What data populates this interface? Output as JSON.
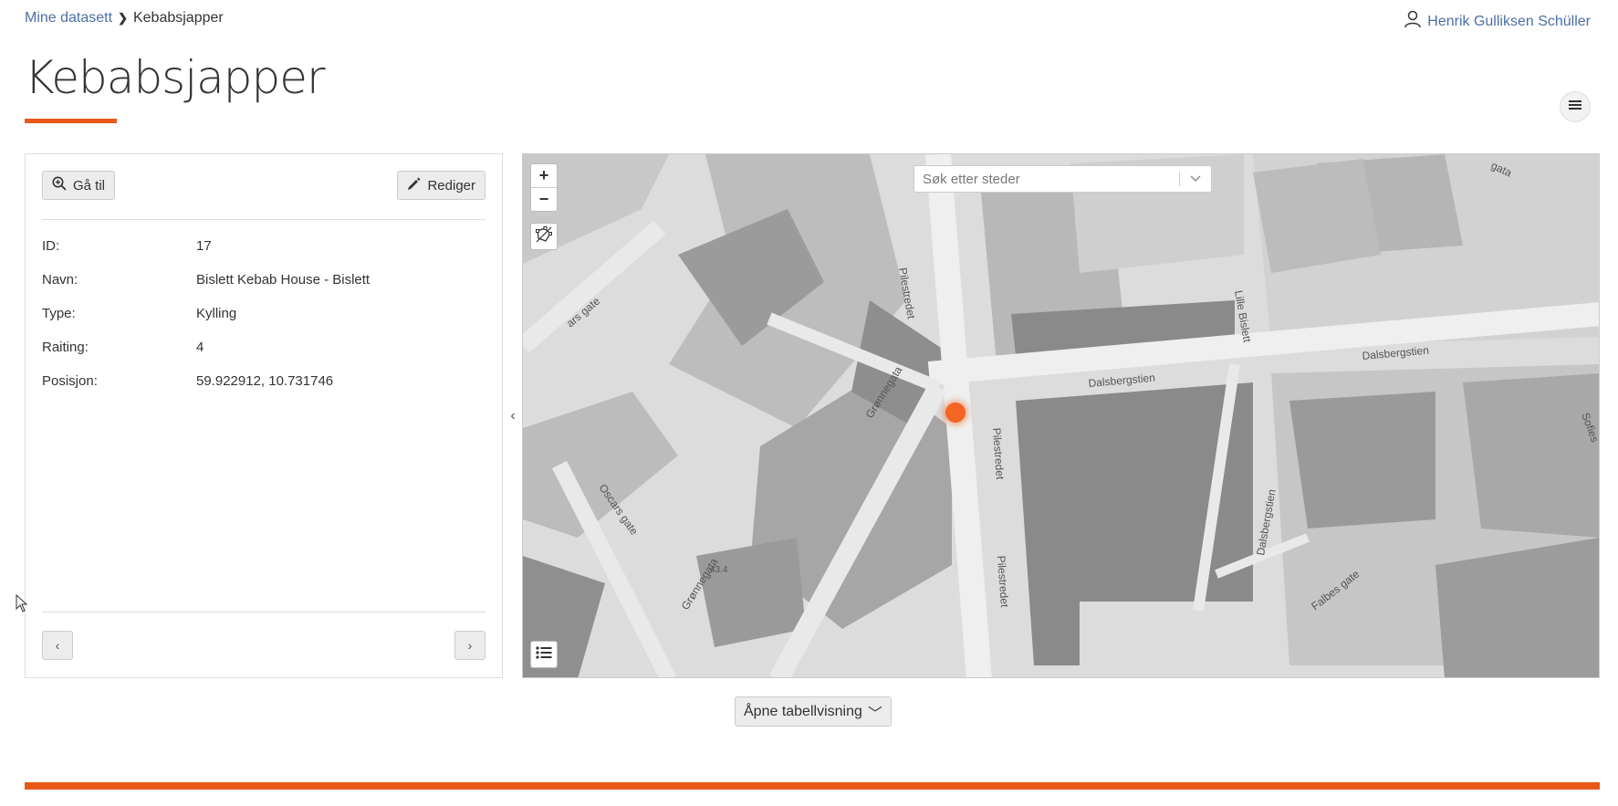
{
  "breadcrumb": {
    "parent": "Mine datasett",
    "current": "Kebabsjapper"
  },
  "user": {
    "name": "Henrik Gulliksen Schüller"
  },
  "page": {
    "title": "Kebabsjapper"
  },
  "detail": {
    "goto_label": "Gå til",
    "edit_label": "Rediger",
    "fields": [
      {
        "label": "ID:",
        "value": "17"
      },
      {
        "label": "Navn:",
        "value": "Bislett Kebab House - Bislett"
      },
      {
        "label": "Type:",
        "value": "Kylling"
      },
      {
        "label": "Raiting:",
        "value": "4"
      },
      {
        "label": "Posisjon:",
        "value": "59.922912, 10.731746"
      }
    ],
    "prev_label": "‹",
    "next_label": "›"
  },
  "collapse_label": "‹",
  "map": {
    "search_placeholder": "Søk etter steder",
    "zoom_in": "+",
    "zoom_out": "−",
    "streets": [
      "Pilestredet",
      "Pilestredet",
      "Pilestredet",
      "Dalsbergstien",
      "Dalsbergstien",
      "Dalsbergstien",
      "Grønnegata",
      "Grønnegata",
      "Oscars gate",
      "Falbes gate",
      "Lille Bislett",
      "Sofies",
      "ars gate",
      "gata",
      "43.4"
    ],
    "marker_color": "#f26522"
  },
  "table_toggle": {
    "label": "Åpne tabellvisning",
    "chevron": "﹀"
  },
  "colors": {
    "accent": "#e8591a",
    "link": "#4a6fa5"
  }
}
